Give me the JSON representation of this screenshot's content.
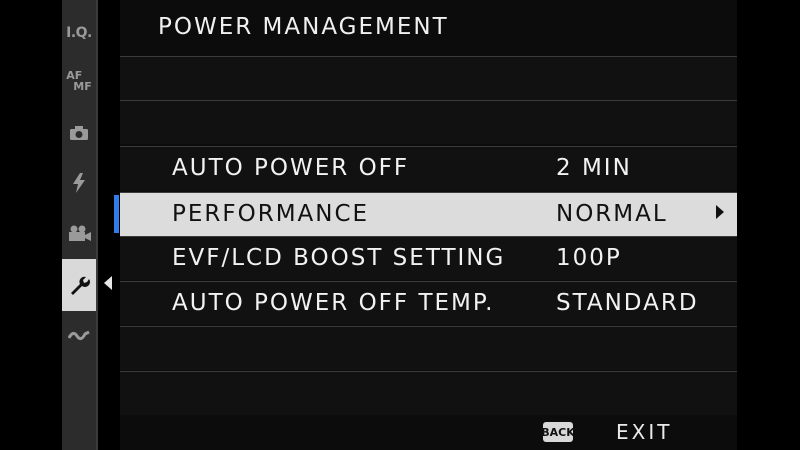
{
  "sidebar": {
    "items": [
      {
        "name": "iq",
        "text": "I.Q."
      },
      {
        "name": "af-mf",
        "text_top": "AF",
        "text_bottom": "MF"
      },
      {
        "name": "camera-icon"
      },
      {
        "name": "flash-icon"
      },
      {
        "name": "movie-icon"
      },
      {
        "name": "wrench-icon"
      },
      {
        "name": "connection-icon"
      }
    ]
  },
  "header": {
    "title": "POWER MANAGEMENT"
  },
  "menu": {
    "items": [
      {
        "label": "AUTO POWER OFF",
        "value": "2 MIN"
      },
      {
        "label": "PERFORMANCE",
        "value": "NORMAL"
      },
      {
        "label": "EVF/LCD BOOST SETTING",
        "value": "100P"
      },
      {
        "label": "AUTO POWER OFF TEMP.",
        "value": "STANDARD"
      }
    ],
    "selected_index": 1
  },
  "footer": {
    "back_label": "BACK",
    "exit_label": "EXIT"
  },
  "colors": {
    "selection_bar": "#2f7de8",
    "selected_row": "#dcdcdc"
  }
}
